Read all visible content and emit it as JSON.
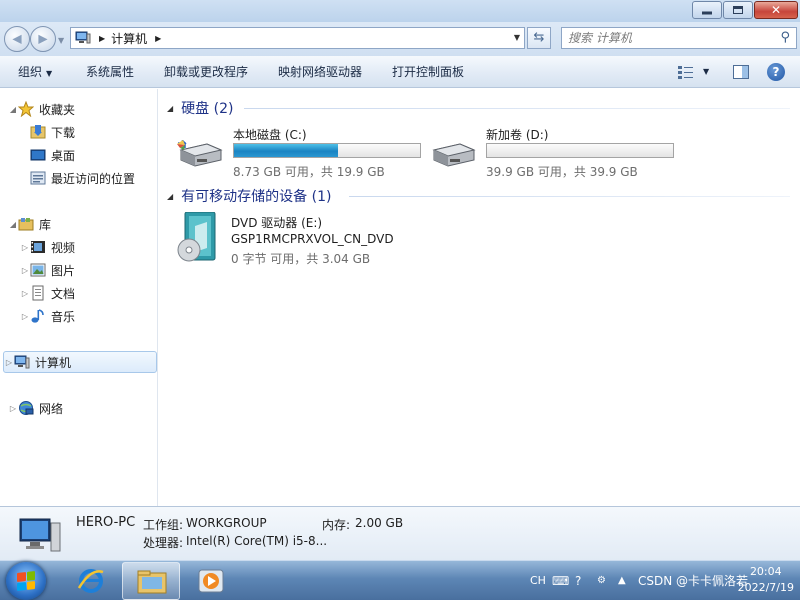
{
  "window": {
    "title": "计算机",
    "caption_buttons": [
      "minimize",
      "maximize",
      "close"
    ]
  },
  "address_bar": {
    "crumbs": [
      "计算机"
    ],
    "search_placeholder": "搜索 计算机"
  },
  "command_bar": {
    "organize": "组织",
    "items": [
      "系统属性",
      "卸载或更改程序",
      "映射网络驱动器",
      "打开控制面板"
    ],
    "help_label": "?"
  },
  "nav_pane": {
    "favorites": {
      "label": "收藏夹",
      "items": [
        "下载",
        "桌面",
        "最近访问的位置"
      ]
    },
    "libraries": {
      "label": "库",
      "items": [
        "视频",
        "图片",
        "文档",
        "音乐"
      ]
    },
    "computer": {
      "label": "计算机"
    },
    "network": {
      "label": "网络"
    }
  },
  "content": {
    "hard_disks": {
      "header": "硬盘 (2)",
      "drives": [
        {
          "name": "本地磁盘 (C:)",
          "free": "8.73 GB 可用，共 19.9 GB",
          "used_fraction": 0.56
        },
        {
          "name": "新加卷 (D:)",
          "free": "39.9 GB 可用，共 39.9 GB",
          "used_fraction": 0.0
        }
      ]
    },
    "removable": {
      "header": "有可移动存储的设备 (1)",
      "dvd": {
        "name": "DVD 驱动器 (E:)",
        "label": "GSP1RMCPRXVOL_CN_DVD",
        "free": "0 字节 可用，共 3.04 GB"
      }
    }
  },
  "details": {
    "pc_name": "HERO-PC",
    "workgroup_label": "工作组:",
    "workgroup": "WORKGROUP",
    "memory_label": "内存:",
    "memory": "2.00 GB",
    "cpu_label": "处理器:",
    "cpu": "Intel(R) Core(TM) i5-8..."
  },
  "taskbar": {
    "lang": "CH",
    "time": "20:04",
    "date": "2022/7/19",
    "watermark": "CSDN @卡卡佩洛若"
  },
  "colors": {
    "group_header": "#1e3287",
    "drive_fill": "#1a84c3",
    "muted_text": "#6d6d6d"
  }
}
